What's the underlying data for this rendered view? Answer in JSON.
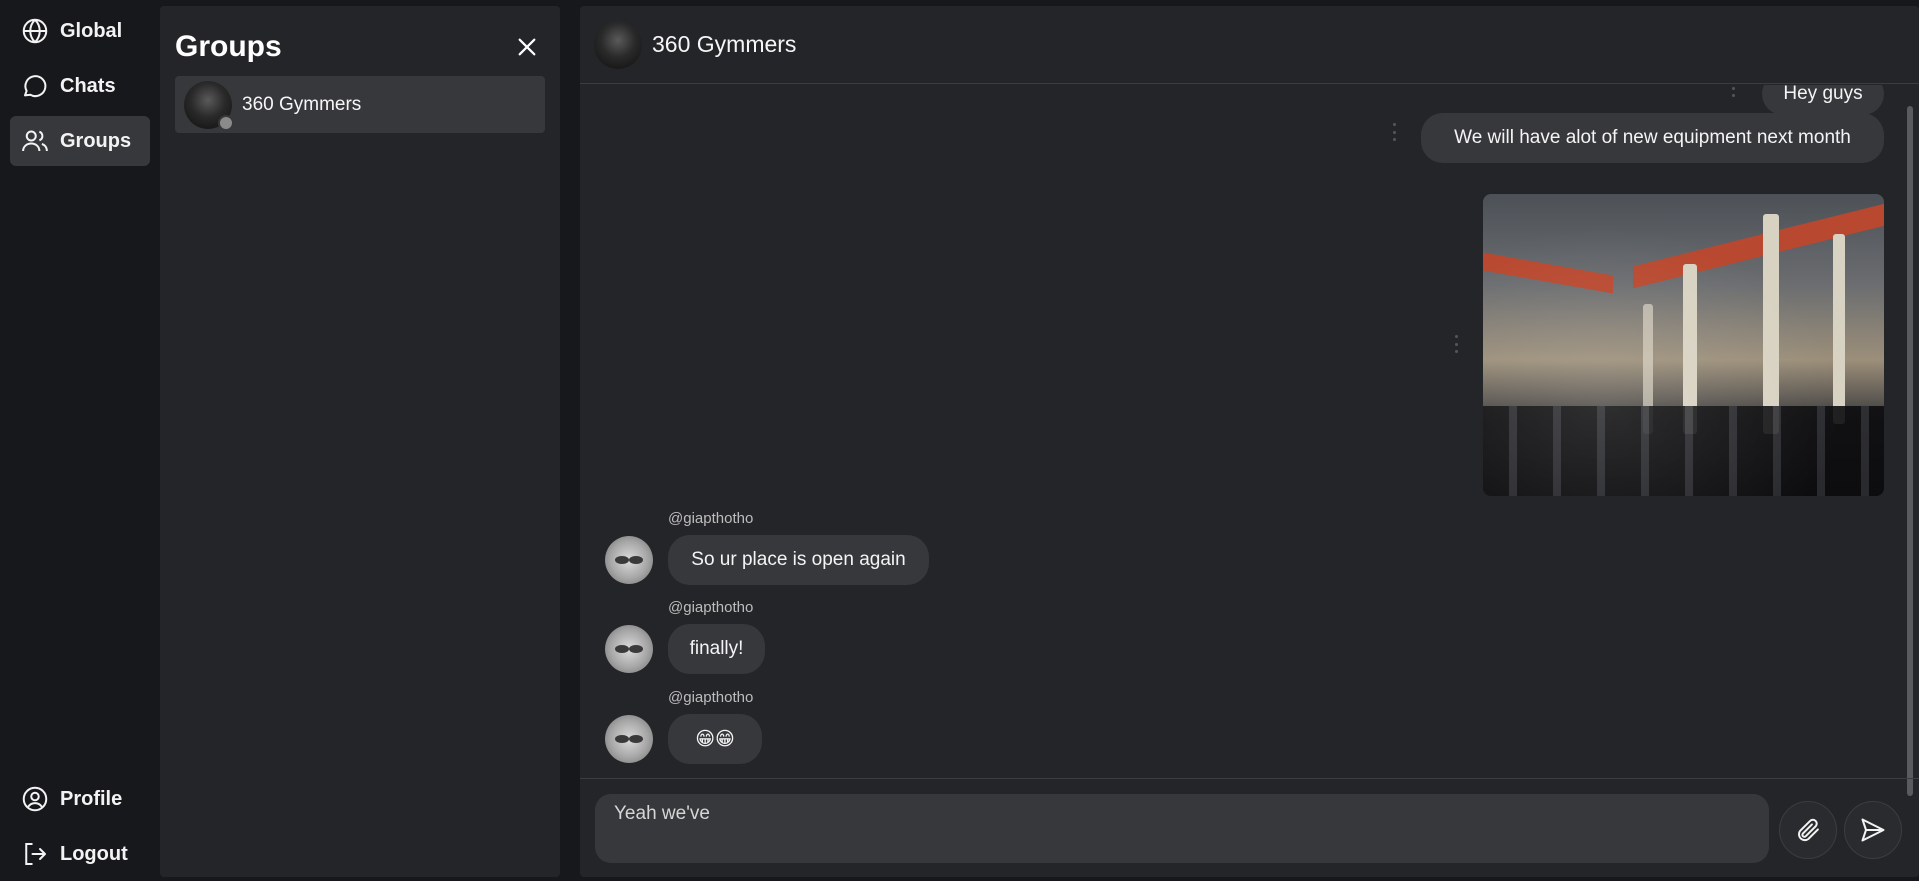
{
  "nav": {
    "global_label": "Global",
    "chats_label": "Chats",
    "groups_label": "Groups",
    "profile_label": "Profile",
    "logout_label": "Logout"
  },
  "groups_panel": {
    "title": "Groups",
    "items": [
      {
        "name": "360 Gymmers",
        "status": "offline"
      }
    ]
  },
  "chat": {
    "title": "360 Gymmers",
    "messages": [
      {
        "side": "outgoing",
        "type": "text",
        "text": "Hey guys"
      },
      {
        "side": "outgoing",
        "type": "text",
        "text": "We will have alot of new equipment next month"
      },
      {
        "side": "outgoing",
        "type": "image",
        "alt": "gym interior photo"
      },
      {
        "side": "incoming",
        "sender": "@giapthotho",
        "type": "text",
        "text": "So ur place is open again"
      },
      {
        "side": "incoming",
        "sender": "@giapthotho",
        "type": "text",
        "text": "finally!"
      },
      {
        "side": "incoming",
        "sender": "@giapthotho",
        "type": "text",
        "text": "😁😁"
      }
    ]
  },
  "composer": {
    "value": "Yeah we've"
  },
  "icons": {
    "global": "globe-icon",
    "chats": "chat-bubble-icon",
    "groups": "users-icon",
    "profile": "user-circle-icon",
    "logout": "logout-icon",
    "close": "close-icon",
    "attach": "paperclip-icon",
    "send": "send-icon",
    "message_menu": "kebab-menu-icon"
  },
  "colors": {
    "background": "#17181b",
    "panel": "#242528",
    "bubble": "#37383c",
    "active_nav": "#37383c"
  }
}
